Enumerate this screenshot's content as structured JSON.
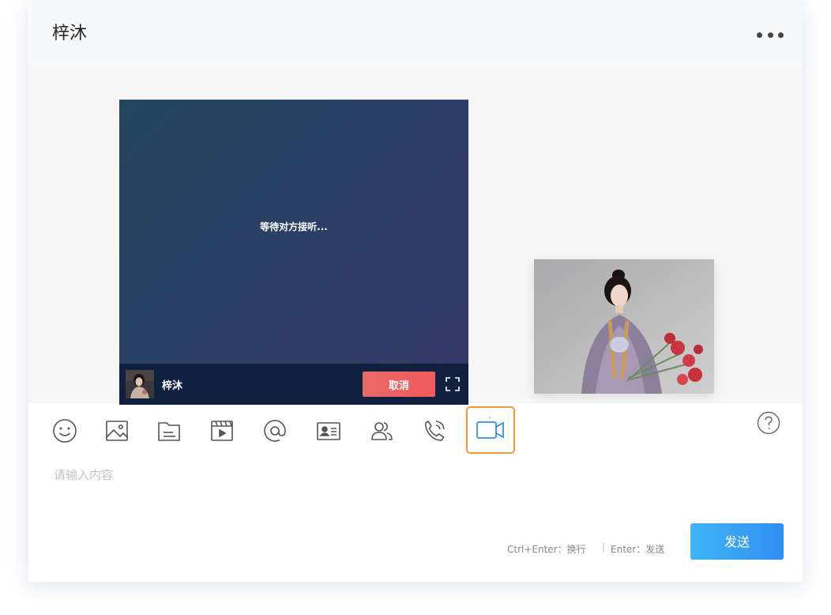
{
  "header": {
    "title": "梓沐",
    "more_icon": "more-horizontal-icon"
  },
  "call": {
    "status_text": "等待对方接听...",
    "caller_name": "梓沐",
    "cancel_label": "取消",
    "fullscreen_icon": "fullscreen-icon"
  },
  "toolbar": {
    "tools": [
      {
        "name": "emoji-icon"
      },
      {
        "name": "image-icon"
      },
      {
        "name": "file-icon"
      },
      {
        "name": "video-file-icon"
      },
      {
        "name": "mention-icon"
      },
      {
        "name": "contact-card-icon"
      },
      {
        "name": "group-icon"
      },
      {
        "name": "voice-call-icon"
      },
      {
        "name": "video-call-icon",
        "active": true
      }
    ],
    "active_border_color": "#f29a38",
    "help_icon": "help-icon"
  },
  "input": {
    "placeholder": "请输入内容",
    "value": ""
  },
  "footer": {
    "hint_newline": "Ctrl+Enter：换行",
    "hint_separator": "|",
    "hint_send": "Enter：发送",
    "send_label": "发送"
  },
  "colors": {
    "accent": "#2f8ff0",
    "cancel": "#f05a5a",
    "video_bg": "#2b3f66"
  }
}
